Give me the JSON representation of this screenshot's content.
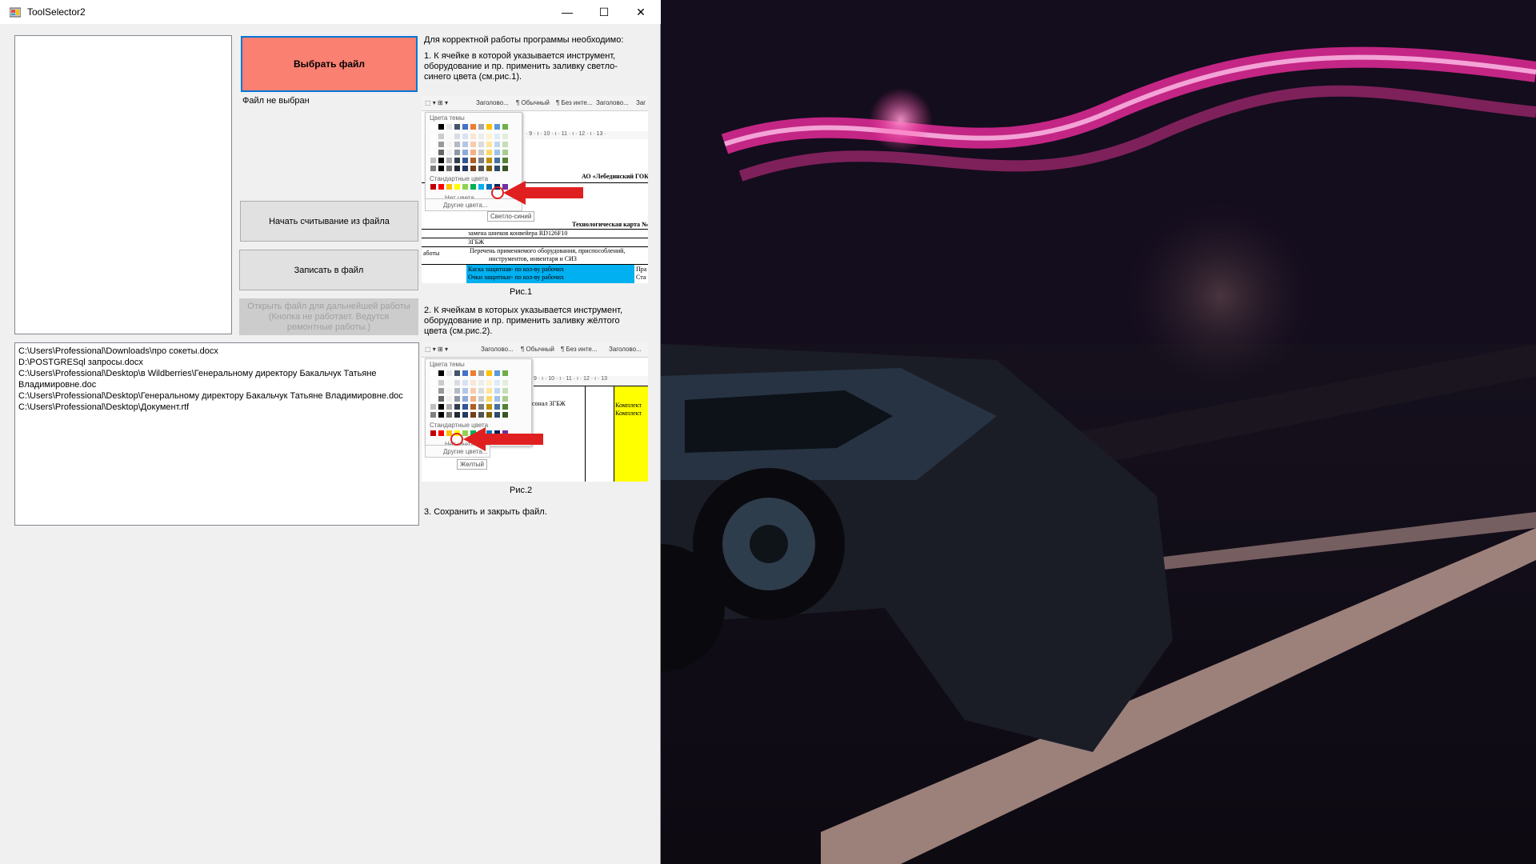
{
  "window": {
    "title": "ToolSelector2",
    "minimize": "—",
    "maximize": "☐",
    "close": "✕"
  },
  "buttons": {
    "choose_file": "Выбрать файл",
    "start_read": "Начать считывание из файла",
    "write_file": "Записать в файл",
    "open_file": "Открыть файл для дальнейшей работы (Кнопка не работает. Ведутся ремонтные работы.)"
  },
  "file_status": "Файл не выбран",
  "paths": [
    "C:\\Users\\Professional\\Downloads\\про сокеты.docx",
    "D:\\POSTGRESql запросы.docx",
    "C:\\Users\\Professional\\Desktop\\в Wildberries\\Генеральному директору Бакальчук Татьяне Владимировне.doc",
    "C:\\Users\\Professional\\Desktop\\Генеральному директору Бакальчук Татьяне Владимировне.doc",
    "C:\\Users\\Professional\\Desktop\\Документ.rtf"
  ],
  "instructions": {
    "intro": "Для корректной работы программы необходимо:",
    "step1": "1. К ячейке в которой указывается инструмент, оборудование и пр. применить заливку светло-синего цвета (см.рис.1).",
    "fig1": "Рис.1",
    "step2": "2. К ячейкам в которых указывается инструмент, оборудование и пр. применить заливку жёлтого цвета (см.рис.2).",
    "fig2": "Рис.2",
    "step3": "3. Сохранить и закрыть файл."
  },
  "fig1": {
    "ribbon": [
      "Заголово...",
      "¶ Обычный",
      "¶ Без инте...",
      "Заголово...",
      "Заг"
    ],
    "theme_colors": "Цвета темы",
    "standard_colors": "Стандартные цвета",
    "no_color": "Нет цвета",
    "more_colors": "Другие цвета...",
    "tooltip": "Светло-синий",
    "ruler": "· 9 · ı · 10 · ı · 11 · ı · 12 · ı · 13 ·",
    "doc_company": "АО «Лебединский ГОК",
    "doc_techcard": "Технологическая карта №",
    "doc_line1": "замена шнеков конвейера RD126F10",
    "doc_line2": "ЗГБЖ",
    "doc_line3": "Перечень применяемого оборудования, приспособлений,",
    "doc_line4": "инструментов, инвентаря и СИЗ",
    "doc_cell1": "Каска защитная- по кол-ву рабочих",
    "doc_cell2": "Очки защитные- по кол-ву рабочих",
    "doc_side": "аботы",
    "doc_right": "Пра",
    "doc_right2": "Ста"
  },
  "fig2": {
    "ribbon": [
      "Заголово...",
      "¶ Обычный",
      "¶ Без инте...",
      "Заголово..."
    ],
    "theme_colors": "Цвета темы",
    "standard_colors": "Стандартные цвета",
    "no_color": "Нет цвета",
    "more_colors": "Другие цвета...",
    "tooltip": "Желтый",
    "ruler": "9 · ı · 10 · ı · 11 · ı · 12 · ı · 13",
    "doc_text": "рсонал ЗГБЖ",
    "doc_yellow1": "Комплект",
    "doc_yellow2": "Комплект"
  },
  "colors": {
    "choose_button": "#fa8072",
    "light_blue": "#00b0f0",
    "yellow": "#ffff00",
    "arrow_red": "#e02020"
  }
}
